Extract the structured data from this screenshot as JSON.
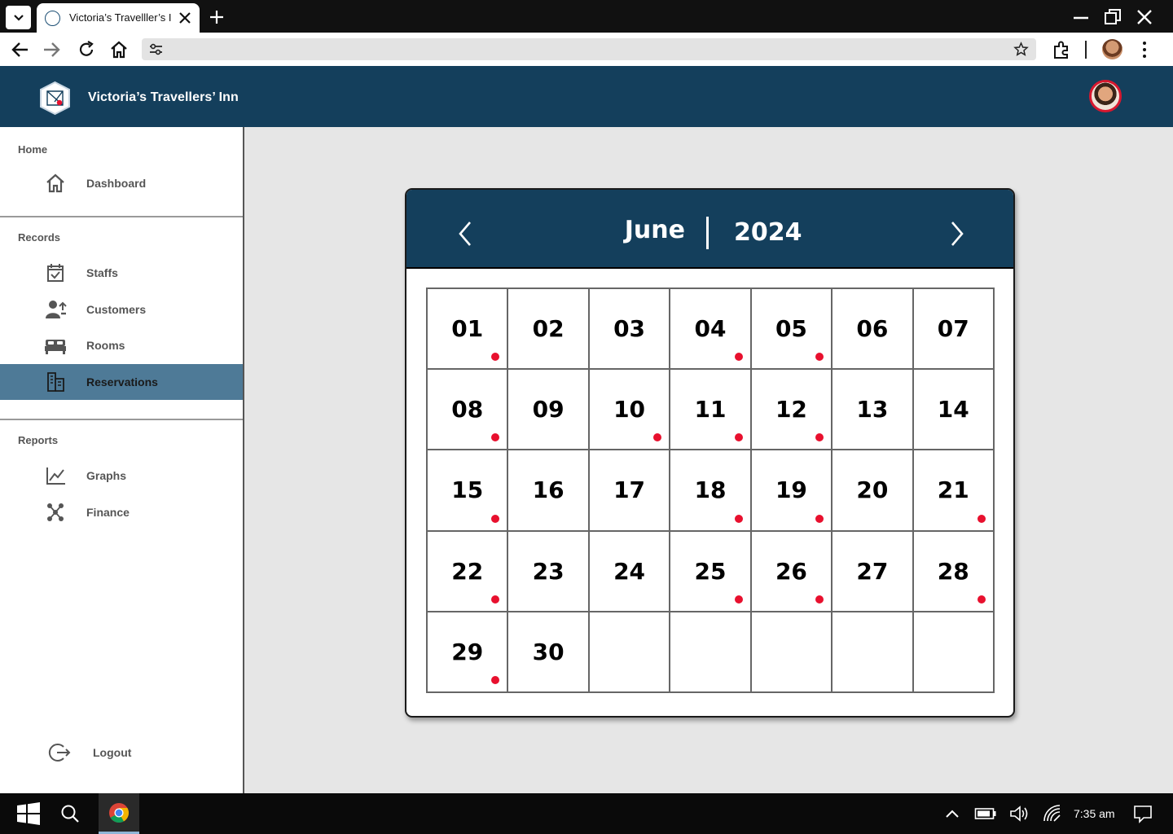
{
  "browser": {
    "tab_title": "Victoria’s Travelller’s Inn",
    "icons": [
      "tab-list-icon",
      "new-tab-icon",
      "minimize-icon",
      "restore-icon",
      "close-icon",
      "back-icon",
      "forward-icon",
      "reload-icon",
      "home-icon",
      "site-settings-icon",
      "bookmark-star-icon",
      "extensions-icon",
      "profile-avatar",
      "more-menu-icon"
    ],
    "url": ""
  },
  "app": {
    "title": "Victoria’s Travellers’ Inn",
    "header_color": "#143f5c"
  },
  "sidebar": {
    "sections": [
      {
        "label": "Home",
        "items": [
          {
            "label": "Dashboard",
            "icon": "home-icon"
          }
        ]
      },
      {
        "label": "Records",
        "items": [
          {
            "label": "Staffs",
            "icon": "calendar-check-icon"
          },
          {
            "label": "Customers",
            "icon": "customers-icon"
          },
          {
            "label": "Rooms",
            "icon": "bed-icon"
          },
          {
            "label": "Reservations",
            "icon": "reservations-icon",
            "active": true
          }
        ]
      },
      {
        "label": "Reports",
        "items": [
          {
            "label": "Graphs",
            "icon": "line-chart-icon"
          },
          {
            "label": "Finance",
            "icon": "network-icon"
          }
        ]
      }
    ],
    "logout_label": "Logout",
    "active_color": "#4e7a97"
  },
  "calendar": {
    "month": "June",
    "year": "2024",
    "days": [
      "01",
      "02",
      "03",
      "04",
      "05",
      "06",
      "07",
      "08",
      "09",
      "10",
      "11",
      "12",
      "13",
      "14",
      "15",
      "16",
      "17",
      "18",
      "19",
      "20",
      "21",
      "22",
      "23",
      "24",
      "25",
      "26",
      "27",
      "28",
      "29",
      "30"
    ],
    "days_with_reservations": [
      "01",
      "04",
      "05",
      "08",
      "10",
      "11",
      "12",
      "15",
      "18",
      "19",
      "21",
      "22",
      "25",
      "26",
      "28",
      "29"
    ],
    "reservation_dot_color": "#e8102e"
  },
  "taskbar": {
    "time": "7:35 am",
    "icons": [
      "windows-start-icon",
      "search-icon",
      "chrome-icon",
      "chevron-up-icon",
      "battery-icon",
      "volume-icon",
      "wifi-icon",
      "notification-icon"
    ]
  }
}
